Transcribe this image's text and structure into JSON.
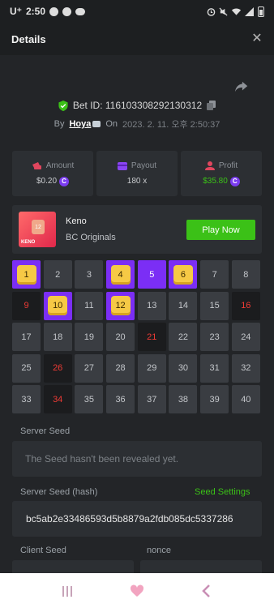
{
  "status_bar": {
    "carrier": "U⁺",
    "time": "2:50"
  },
  "header": {
    "title": "Details"
  },
  "bet": {
    "id_label": "Bet ID: 116103308292130312",
    "by_label": "By",
    "user": "Hoya",
    "on_label": "On",
    "date": "2023. 2. 11. 오후 2:50:37"
  },
  "stats": [
    {
      "label": "Amount",
      "value": "$0.20",
      "icon": "amount-icon",
      "color": "#c9cbce"
    },
    {
      "label": "Payout",
      "value": "180 x",
      "icon": "payout-icon",
      "color": "#c9cbce"
    },
    {
      "label": "Profit",
      "value": "$35.80",
      "icon": "profit-icon",
      "color": "#3bc117"
    }
  ],
  "game": {
    "name": "Keno",
    "provider": "BC Originals",
    "play_label": "Play Now",
    "thumb_ball": "12",
    "thumb_text": "KENO"
  },
  "grid": [
    {
      "n": "1",
      "s": "hit"
    },
    {
      "n": "2",
      "s": "normal"
    },
    {
      "n": "3",
      "s": "normal"
    },
    {
      "n": "4",
      "s": "hit"
    },
    {
      "n": "5",
      "s": "pick"
    },
    {
      "n": "6",
      "s": "hit"
    },
    {
      "n": "7",
      "s": "normal"
    },
    {
      "n": "8",
      "s": "normal"
    },
    {
      "n": "9",
      "s": "miss"
    },
    {
      "n": "10",
      "s": "hit"
    },
    {
      "n": "11",
      "s": "normal"
    },
    {
      "n": "12",
      "s": "hit"
    },
    {
      "n": "13",
      "s": "normal"
    },
    {
      "n": "14",
      "s": "normal"
    },
    {
      "n": "15",
      "s": "normal"
    },
    {
      "n": "16",
      "s": "miss"
    },
    {
      "n": "17",
      "s": "normal"
    },
    {
      "n": "18",
      "s": "normal"
    },
    {
      "n": "19",
      "s": "normal"
    },
    {
      "n": "20",
      "s": "normal"
    },
    {
      "n": "21",
      "s": "miss"
    },
    {
      "n": "22",
      "s": "normal"
    },
    {
      "n": "23",
      "s": "normal"
    },
    {
      "n": "24",
      "s": "normal"
    },
    {
      "n": "25",
      "s": "normal"
    },
    {
      "n": "26",
      "s": "miss"
    },
    {
      "n": "27",
      "s": "normal"
    },
    {
      "n": "28",
      "s": "normal"
    },
    {
      "n": "29",
      "s": "normal"
    },
    {
      "n": "30",
      "s": "normal"
    },
    {
      "n": "31",
      "s": "normal"
    },
    {
      "n": "32",
      "s": "normal"
    },
    {
      "n": "33",
      "s": "normal"
    },
    {
      "n": "34",
      "s": "miss"
    },
    {
      "n": "35",
      "s": "normal"
    },
    {
      "n": "36",
      "s": "normal"
    },
    {
      "n": "37",
      "s": "normal"
    },
    {
      "n": "38",
      "s": "normal"
    },
    {
      "n": "39",
      "s": "normal"
    },
    {
      "n": "40",
      "s": "normal"
    }
  ],
  "seeds": {
    "server_seed_label": "Server Seed",
    "server_seed_value": "The Seed hasn't been revealed yet.",
    "server_hash_label": "Server Seed (hash)",
    "settings_link": "Seed Settings",
    "server_hash_value": "bc5ab2e33486593d5b8879a2fdb085dc5337286",
    "client_seed_label": "Client Seed",
    "nonce_label": "nonce"
  },
  "colors": {
    "accent_green": "#3bc117",
    "purple": "#7b2ef5",
    "miss_red": "#ef3b35",
    "gem_yellow": "#f6c945"
  }
}
